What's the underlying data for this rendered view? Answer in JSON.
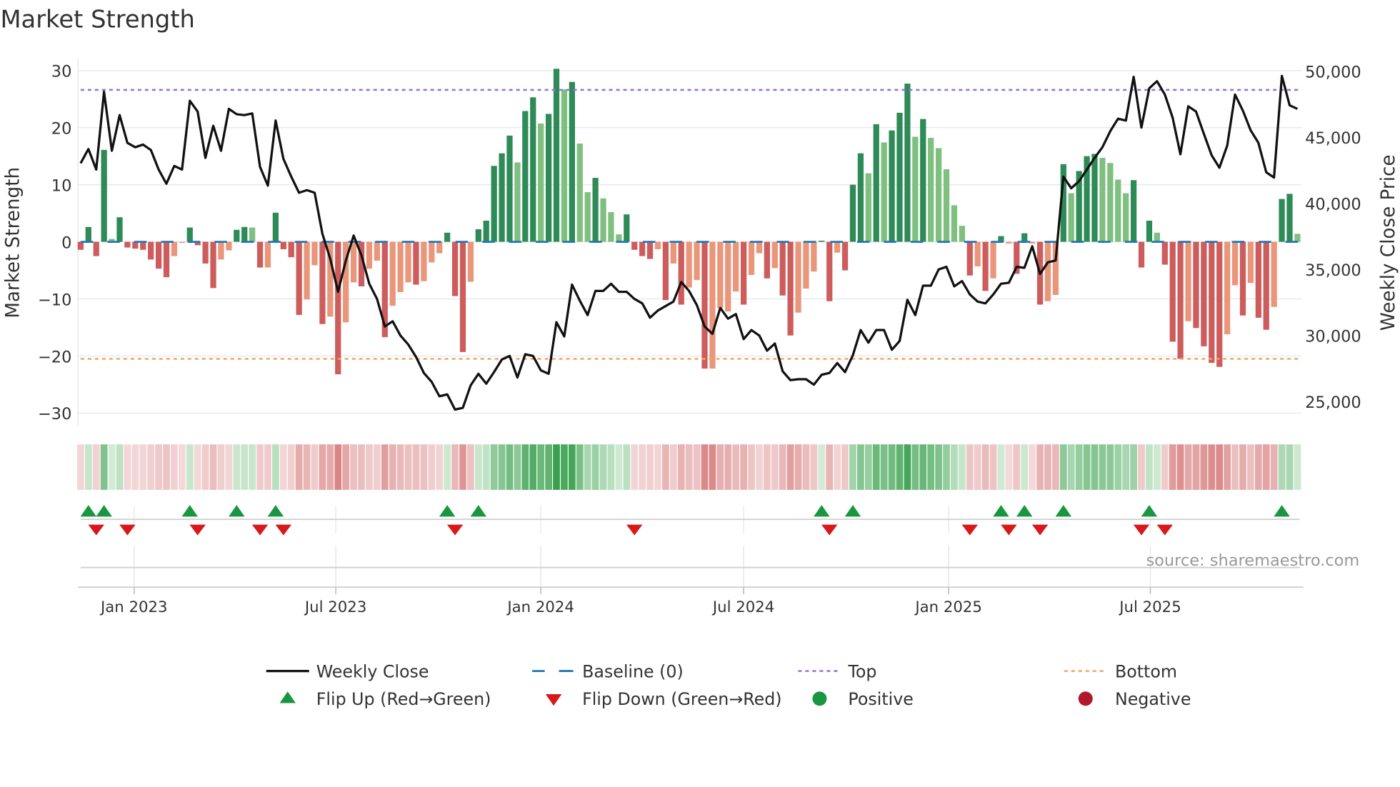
{
  "chart_data": {
    "type": "bar",
    "title": "Market Strength",
    "ylabel": "Market Strength",
    "y2label": "Weekly Close Price",
    "ylim": [
      -32,
      32
    ],
    "y2lim": [
      23000,
      51000
    ],
    "x_start": "2022-11-14",
    "x_step_days": 7,
    "y_ticks": [
      {
        "v": 30,
        "label": "30"
      },
      {
        "v": 20,
        "label": "20"
      },
      {
        "v": 10,
        "label": "10"
      },
      {
        "v": 0,
        "label": "0"
      },
      {
        "v": -10,
        "label": "−10"
      },
      {
        "v": -20,
        "label": "−20"
      },
      {
        "v": -30,
        "label": "−30"
      }
    ],
    "y2_ticks": [
      {
        "v": 50000,
        "label": "50,000"
      },
      {
        "v": 45000,
        "label": "45,000"
      },
      {
        "v": 40000,
        "label": "40,000"
      },
      {
        "v": 35000,
        "label": "35,000"
      },
      {
        "v": 30000,
        "label": "30,000"
      },
      {
        "v": 25000,
        "label": "25,000"
      }
    ],
    "x_ticks": [
      {
        "date": "2023-01-01",
        "label": "Jan 2023"
      },
      {
        "date": "2023-07-01",
        "label": "Jul 2023"
      },
      {
        "date": "2024-01-01",
        "label": "Jan 2024"
      },
      {
        "date": "2024-07-01",
        "label": "Jul 2024"
      },
      {
        "date": "2025-01-01",
        "label": "Jan 2025"
      },
      {
        "date": "2025-07-01",
        "label": "Jul 2025"
      }
    ],
    "top_level": 26.6,
    "bottom_level": -20.5,
    "baseline": 0,
    "strength": [
      -1.4,
      2.6,
      -2.5,
      16.1,
      0.5,
      4.3,
      -1,
      -1.2,
      -1.4,
      -3.1,
      -4.7,
      -6.2,
      -2.5,
      -0.2,
      2.5,
      -0.6,
      -3.8,
      -8.1,
      -3.1,
      -1.5,
      2.1,
      2.6,
      2.5,
      -4.5,
      -4.5,
      5.1,
      -1.3,
      -2.7,
      -12.8,
      -10.1,
      -4.1,
      -14.4,
      -13.1,
      -23.2,
      -14.1,
      -7.1,
      -7.8,
      -4.7,
      -3.3,
      -16.7,
      -11.2,
      -8.8,
      -7.1,
      -7.5,
      -6.9,
      -3.6,
      -2,
      1.6,
      -9.5,
      -19.3,
      -7,
      2.2,
      3.7,
      13.3,
      15.5,
      18.6,
      13.9,
      22.9,
      25.3,
      20.7,
      22.4,
      30.3,
      26.7,
      28,
      17.2,
      8.7,
      11.2,
      7.6,
      5.2,
      1.3,
      4.8,
      -1.4,
      -2.5,
      -3,
      -1.3,
      -10.2,
      -3.8,
      -11,
      -8,
      -6.7,
      -22.2,
      -22.2,
      -11.6,
      -12.2,
      -8.7,
      -11,
      -5.8,
      -2,
      -6.4,
      -4.6,
      -9.4,
      -16.4,
      -12.4,
      -8.2,
      -5.2,
      0.2,
      -10.4,
      -1.9,
      -5,
      10,
      15.5,
      12,
      20.6,
      17.4,
      19.5,
      22.6,
      27.7,
      18.4,
      21.5,
      18.2,
      16.4,
      12.7,
      6.4,
      2.8,
      -5.9,
      -4.3,
      -8.6,
      -6.4,
      1,
      -0.3,
      -5.6,
      1.5,
      -0.3,
      -11,
      -10.4,
      -9.3,
      13.6,
      8.5,
      12.4,
      15,
      15.4,
      14.7,
      13.8,
      10.9,
      8.5,
      10.8,
      -4.5,
      3.7,
      1.6,
      -4,
      -17.5,
      -20.5,
      -13.9,
      -15.1,
      -18.3,
      -21.2,
      -21.9,
      -16.2,
      -7.6,
      -12.9,
      -7.2,
      -13.3,
      -15.4,
      -11.4,
      7.5,
      8.4,
      1.4
    ],
    "shades": "DDDDLDDDDDDDLLDDDDLLDDLDLDDDDLLDLDLLDLLDLLLDLLLDDDLDDDDDLDDLDDLDLLDLLLDDDDLDLDLLDLLLLDLLDLDDLLLDDLDDDLDLDDDLDLLLLLDLDLDLDDLDLLDLDDDLLLLDDDLDDDLDDDDLLDLDDLDDL",
    "weekly_close": [
      43040,
      44120,
      42570,
      48450,
      43990,
      46690,
      44590,
      44260,
      44460,
      44050,
      42570,
      41490,
      42840,
      42570,
      47770,
      46960,
      43450,
      45880,
      43990,
      47160,
      46760,
      46690,
      46820,
      42770,
      41350,
      46280,
      43380,
      42030,
      40810,
      41010,
      40810,
      37700,
      35810,
      33310,
      35680,
      37570,
      36080,
      33920,
      32770,
      30680,
      31080,
      30000,
      29320,
      28380,
      27160,
      26490,
      25400,
      25540,
      24390,
      24530,
      26220,
      27100,
      26350,
      27230,
      28180,
      28450,
      26820,
      28580,
      28450,
      27360,
      27100,
      31010,
      29930,
      33850,
      32630,
      31550,
      33380,
      33380,
      33920,
      33310,
      33310,
      32770,
      32430,
      31350,
      31890,
      32230,
      32570,
      34050,
      33380,
      32300,
      30680,
      30130,
      32090,
      31280,
      31620,
      29730,
      30410,
      30000,
      28850,
      29390,
      27300,
      26620,
      26690,
      26690,
      26280,
      27030,
      27160,
      27910,
      27230,
      28510,
      30410,
      29460,
      30410,
      30410,
      28920,
      29590,
      32700,
      31550,
      33780,
      33780,
      35000,
      35200,
      33720,
      34120,
      33110,
      32570,
      32430,
      33110,
      33920,
      33990,
      35200,
      35130,
      36760,
      34660,
      35540,
      35680,
      42030,
      41150,
      41690,
      42570,
      43450,
      44260,
      45470,
      46420,
      46280,
      49590,
      45740,
      48720,
      49260,
      48240,
      46490,
      43720,
      47360,
      46960,
      45270,
      43650,
      42700,
      44390,
      48240,
      47030,
      45540,
      44590,
      42360,
      41960,
      49660,
      47430,
      47160
    ],
    "flip_up_weeks": [
      1,
      3,
      14,
      20,
      25,
      47,
      51,
      95,
      99,
      118,
      121,
      126,
      137,
      154
    ],
    "flip_down_weeks": [
      2,
      6,
      15,
      23,
      26,
      48,
      71,
      96,
      114,
      119,
      123,
      136,
      139
    ],
    "legend": {
      "weekly_close": "Weekly Close",
      "baseline": "Baseline (0)",
      "top": "Top",
      "bottom": "Bottom",
      "flip_up": "Flip Up (Red→Green)",
      "flip_down": "Flip Down (Green→Red)",
      "positive": "Positive",
      "negative": "Negative"
    },
    "source": "source: sharemaestro.com",
    "colors": {
      "pos_dark": "#2e8b57",
      "pos_light": "#7fbf7f",
      "neg_dark": "#cd5c5c",
      "neg_light": "#e9967a",
      "line": "#111111",
      "baseline": "#1f77b4",
      "top": "#9370db",
      "bottom": "#f4a460",
      "flip_up": "#1a9641",
      "flip_down": "#d7191c",
      "positive": "#1a9641",
      "negative": "#b2182b"
    }
  }
}
